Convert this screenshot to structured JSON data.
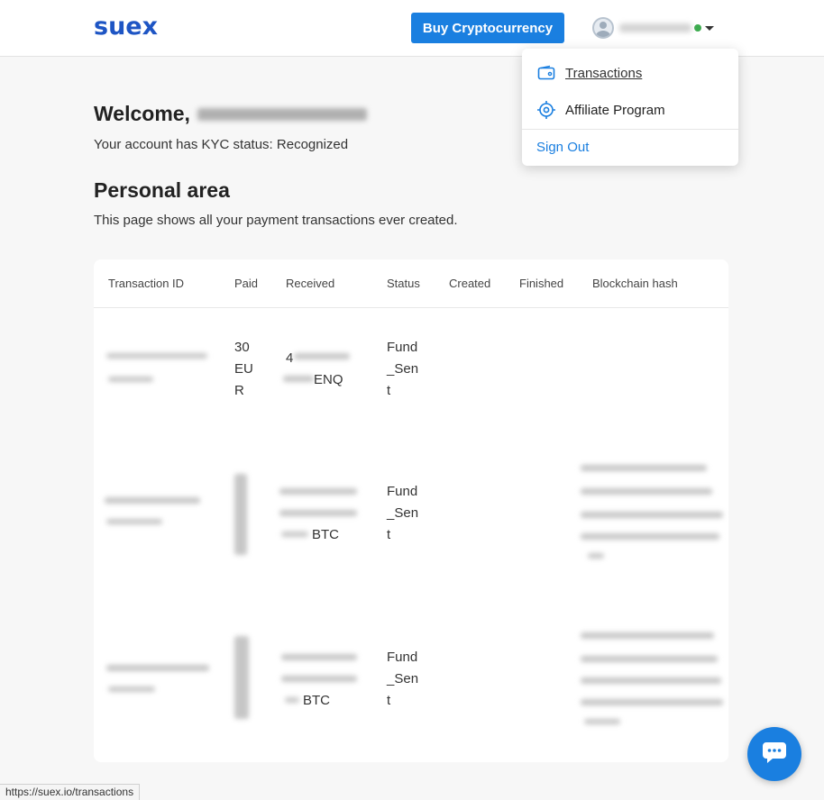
{
  "header": {
    "logo": "suex",
    "buy_button": "Buy Cryptocurrency"
  },
  "menu": {
    "transactions": "Transactions",
    "affiliate": "Affiliate Program",
    "signout": "Sign Out"
  },
  "welcome": {
    "greeting": "Welcome,",
    "kyc": "Your account has KYC status: Recognized"
  },
  "personal": {
    "title": "Personal area",
    "description": "This page shows all your payment transactions ever created."
  },
  "table": {
    "headers": [
      "Transaction ID",
      "Paid",
      "Received",
      "Status",
      "Created",
      "Finished",
      "Blockchain hash"
    ],
    "rows": [
      {
        "paid": "30 EUR",
        "received_prefix": "4",
        "received_currency": "ENQ",
        "status": "Fund_Sent"
      },
      {
        "received_currency": "BTC",
        "status": "Fund_Sent"
      },
      {
        "received_currency": "BTC",
        "status": "Fund_Sent"
      }
    ]
  },
  "status_bar": {
    "url": "https://suex.io/transactions"
  },
  "icons": {
    "wallet": "wallet-icon",
    "target": "target-icon",
    "chat": "chat-icon",
    "avatar": "user-avatar-icon"
  },
  "colors": {
    "brand": "#1e55c4",
    "accent": "#1a7fe0",
    "online": "#3cab4e"
  }
}
